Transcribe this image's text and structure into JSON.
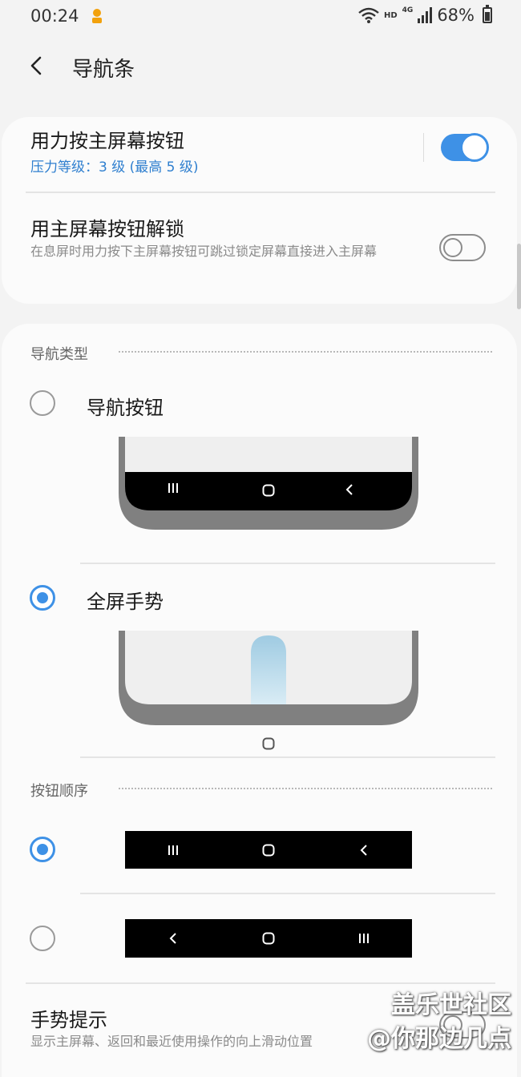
{
  "status_bar": {
    "time": "00:24",
    "hd_label": "HD",
    "network_label": "4G",
    "battery_text": "68%",
    "battery_level": 0.68
  },
  "header": {
    "title": "导航条"
  },
  "settings": {
    "force_press": {
      "title": "用力按主屏幕按钮",
      "subtitle": "压力等级：3 级 (最高 5 级)",
      "enabled": true
    },
    "unlock_home": {
      "title": "用主屏幕按钮解锁",
      "subtitle": "在息屏时用力按下主屏幕按钮可跳过锁定屏幕直接进入主屏幕",
      "enabled": false
    }
  },
  "nav_type": {
    "header": "导航类型",
    "options": [
      {
        "label": "导航按钮",
        "selected": false
      },
      {
        "label": "全屏手势",
        "selected": true
      }
    ]
  },
  "button_order": {
    "header": "按钮顺序",
    "options": [
      {
        "order": [
          "recents",
          "home",
          "back"
        ],
        "selected": true
      },
      {
        "order": [
          "back",
          "home",
          "recents"
        ],
        "selected": false
      }
    ]
  },
  "gesture_hint": {
    "title": "手势提示",
    "subtitle": "显示主屏幕、返回和最近使用操作的向上滑动位置",
    "enabled": false
  },
  "watermark": {
    "line1": "盖乐世社区",
    "line2": "@你那边几点"
  },
  "colors": {
    "accent": "#3e91e6",
    "subtitle_blue": "#2f7fcf",
    "background": "#f3f3f3",
    "card": "#fbfbfb"
  }
}
